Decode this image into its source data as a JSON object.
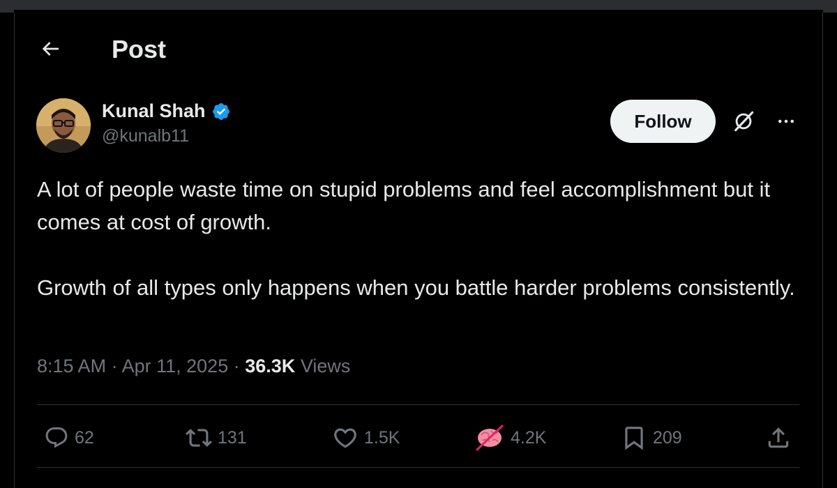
{
  "header": {
    "title": "Post",
    "back_icon": "arrow-left-icon"
  },
  "author": {
    "display_name": "Kunal Shah",
    "handle": "@kunalb11",
    "verified": true,
    "verified_color": "#1d9bf0"
  },
  "actions_top": {
    "follow_label": "Follow",
    "grok_icon": "grok-icon",
    "more_icon": "more-horizontal-icon"
  },
  "post": {
    "paragraphs": [
      "A lot of people waste time on stupid problems and feel accomplishment but it comes at cost of growth.",
      "Growth of all types only happens when you battle harder problems consistently."
    ],
    "time": "8:15 AM",
    "date": "Apr 11, 2025",
    "views_count": "36.3K",
    "views_label": "Views"
  },
  "engagement": {
    "replies": "62",
    "reposts": "131",
    "likes": "1.5K",
    "custom_reaction": "4.2K",
    "bookmarks": "209"
  },
  "colors": {
    "background": "#000000",
    "text_primary": "#e7e9ea",
    "text_secondary": "#71767b",
    "divider": "#2f3336",
    "follow_bg": "#eff3f4"
  }
}
